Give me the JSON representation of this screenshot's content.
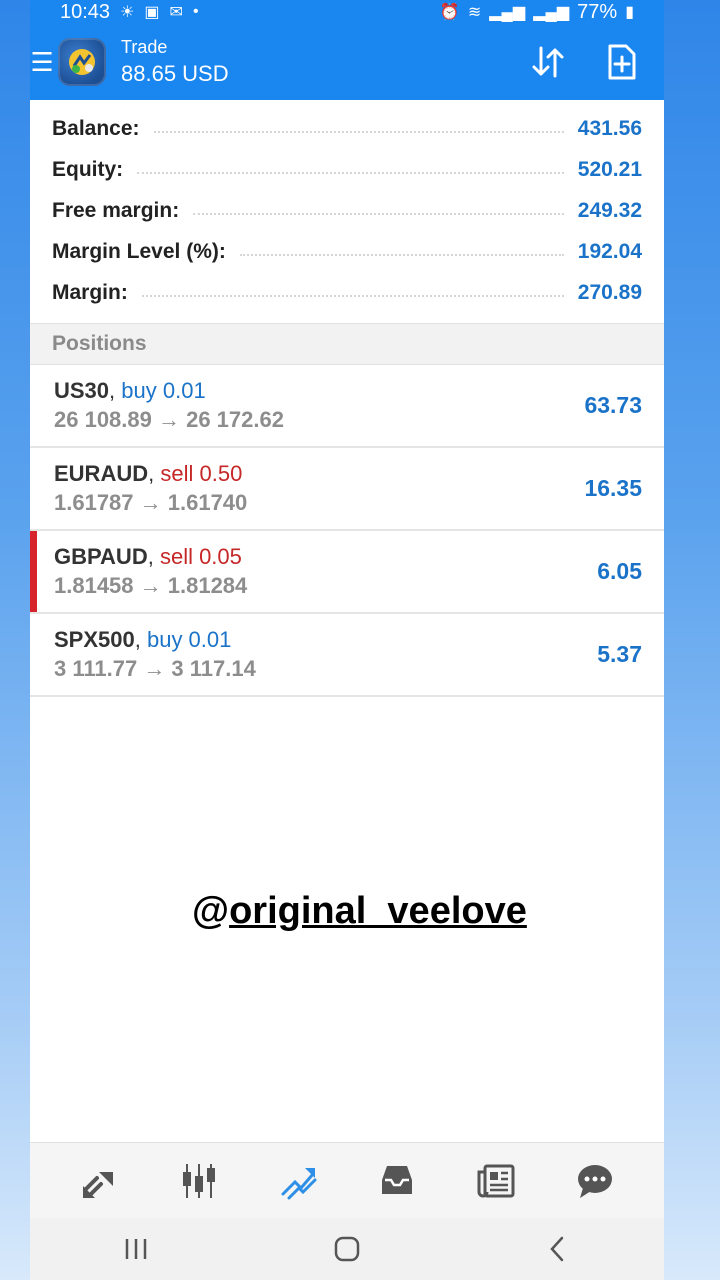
{
  "status_bar": {
    "time": "10:43",
    "battery": "77%"
  },
  "header": {
    "title": "Trade",
    "subtitle": "88.65 USD",
    "icons": [
      "menu-icon",
      "app-logo",
      "sort-icon",
      "new-order-icon"
    ]
  },
  "summary": [
    {
      "label": "Balance:",
      "value": "431.56"
    },
    {
      "label": "Equity:",
      "value": "520.21"
    },
    {
      "label": "Free margin:",
      "value": "249.32"
    },
    {
      "label": "Margin Level (%):",
      "value": "192.04"
    },
    {
      "label": "Margin:",
      "value": "270.89"
    }
  ],
  "positions_header": "Positions",
  "positions": [
    {
      "symbol": "US30",
      "side": "buy 0.01",
      "prices": "26 108.89 → 26 172.62",
      "profit": "63.73"
    },
    {
      "symbol": "EURAUD",
      "side": "sell 0.50",
      "prices": "1.61787 → 1.61740",
      "profit": "16.35"
    },
    {
      "symbol": "GBPAUD",
      "side": "sell 0.05",
      "prices": "1.81458 → 1.81284",
      "profit": "6.05"
    },
    {
      "symbol": "SPX500",
      "side": "buy 0.01",
      "prices": "3 111.77 → 3 117.14",
      "profit": "5.37"
    }
  ],
  "watermark": {
    "at": "@",
    "handle": "original_veelove"
  },
  "bottom_nav": [
    "quotes-icon",
    "chart-icon",
    "trade-icon",
    "history-icon",
    "news-icon",
    "chat-icon"
  ],
  "colors": {
    "brand_blue": "#1a86f0",
    "value_blue": "#1a73c8",
    "sell_red": "#c62828",
    "marker_red": "#d6232c"
  }
}
